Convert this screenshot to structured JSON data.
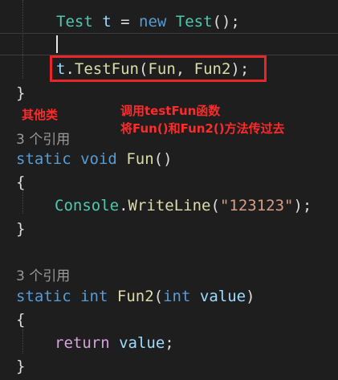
{
  "code": {
    "line1": {
      "type": "Test",
      "var": "t",
      "eq": " = ",
      "new": "new",
      "ctor": "Test",
      "end": "();"
    },
    "line3": {
      "obj": "t",
      "dot": ".",
      "method": "TestFun",
      "open": "(",
      "arg1": "Fun",
      "comma": ", ",
      "arg2": "Fun2",
      "end": ");"
    },
    "close_brace_1": "}",
    "ref_count_1": "3 个引用",
    "fun_sig": {
      "static": "static",
      "void": "void",
      "name": "Fun",
      "paren": "()"
    },
    "open_brace_2": "{",
    "console_line": {
      "cls": "Console",
      "dot": ".",
      "method": "WriteLine",
      "open": "(",
      "str": "\"123123\"",
      "end": ");"
    },
    "close_brace_2": "}",
    "ref_count_2": "3 个引用",
    "fun2_sig": {
      "static": "static",
      "int": "int",
      "name": "Fun2",
      "open": "(",
      "ptype": "int",
      "pname": "value",
      "close": ")"
    },
    "open_brace_3": "{",
    "return_line": {
      "kw": "return",
      "val": "value",
      "end": ";"
    },
    "close_brace_3": "}"
  },
  "annotations": {
    "other_class": "其他类",
    "call_note_line1": "调用testFun函数",
    "call_note_line2": "将Fun()和Fun2()方法传过去"
  },
  "colors": {
    "background": "#1e1e1e",
    "highlight_box": "#e8262a",
    "annotation_text": "#ff2a2a"
  }
}
